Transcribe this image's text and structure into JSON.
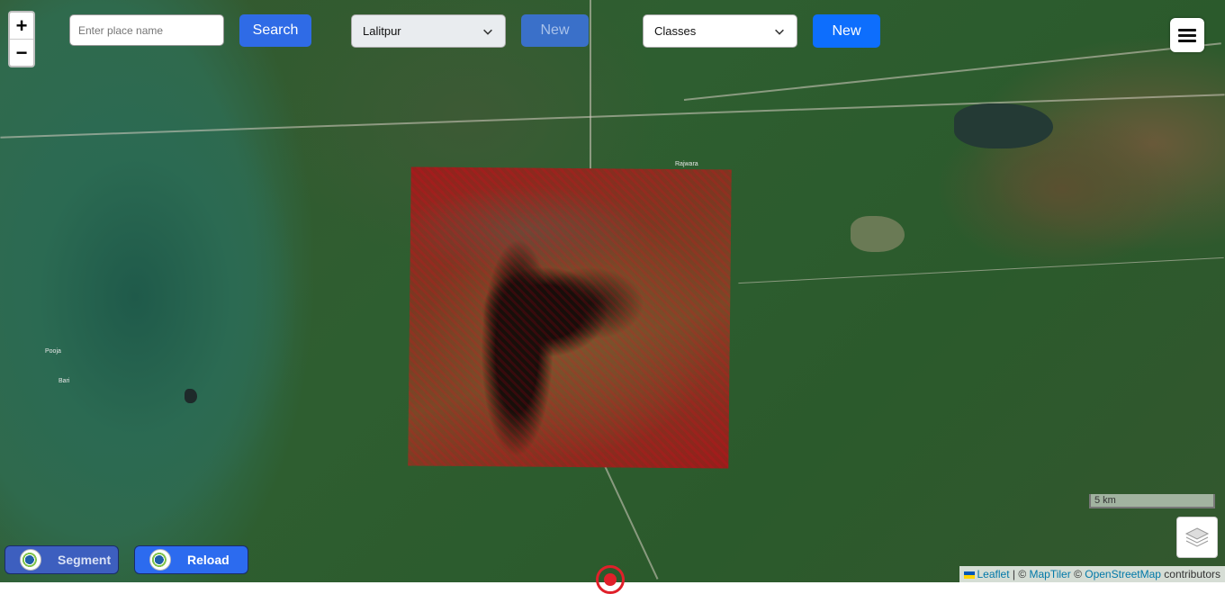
{
  "zoom": {
    "in_label": "+",
    "out_label": "−"
  },
  "search": {
    "placeholder": "Enter place name",
    "button_label": "Search"
  },
  "region_select": {
    "selected": "Lalitpur",
    "new_label": "New"
  },
  "class_select": {
    "selected": "Classes",
    "new_label": "New"
  },
  "map": {
    "town_labels": [
      "Rajwara",
      "Pooja",
      "Bari"
    ],
    "scale_label": "5 km",
    "attribution": {
      "leaflet": "Leaflet",
      "sep1": " | © ",
      "maptiler": "MapTiler",
      "sep2": " © ",
      "osm": "OpenStreetMap",
      "suffix": " contributors"
    }
  },
  "bottom_buttons": {
    "segment_label": "Segment",
    "reload_label": "Reload"
  },
  "colors": {
    "primary": "#0d6efd",
    "search_btn": "#2f6be6",
    "marker": "#e0202a"
  }
}
